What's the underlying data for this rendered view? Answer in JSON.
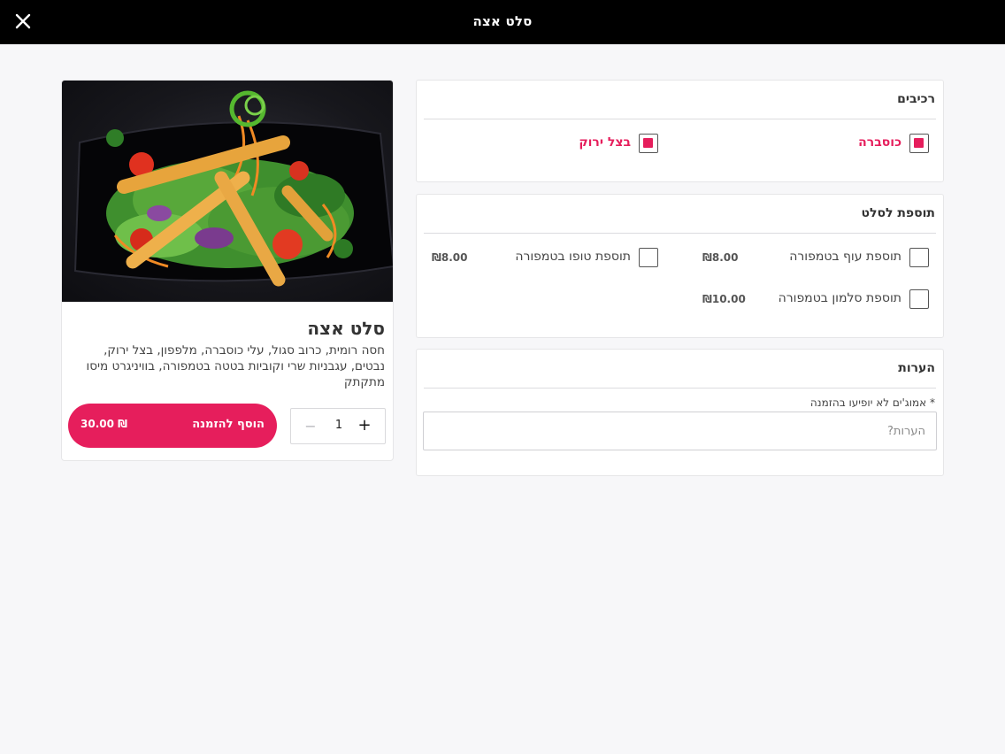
{
  "header": {
    "title": "סלט אצה",
    "close_icon": "close-icon"
  },
  "product": {
    "name": "סלט אצה",
    "description": "חסה רומית, כרוב סגול, עלי כוסברה, מלפפון, בצל ירוק, נבטים, עגבניות שרי וקוביות בטטה בטמפורה, בוויניגרט מיסו מתקתק",
    "quantity": "1",
    "add_label": "הוסף להזמנה",
    "price": "30.00 ₪",
    "image": "salad-photo"
  },
  "ingredients": {
    "title": "רכיבים",
    "items": [
      {
        "label": "כוסברה",
        "checked": true
      },
      {
        "label": "בצל ירוק",
        "checked": true
      }
    ]
  },
  "addons": {
    "title": "תוספת לסלט",
    "items": [
      {
        "label": "תוספת עוף בטמפורה",
        "price": "₪8.00",
        "checked": false
      },
      {
        "label": "תוספת טופו בטמפורה",
        "price": "₪8.00",
        "checked": false
      },
      {
        "label": "תוספת סלמון בטמפורה",
        "price": "₪10.00",
        "checked": false
      }
    ]
  },
  "notes": {
    "title": "הערות",
    "hint": "* אמוג'ים לא יופיעו בהזמנה",
    "placeholder": "הערות?"
  },
  "colors": {
    "accent": "#e61e5c",
    "header_bg": "#000000",
    "page_bg": "#f7f7f9"
  }
}
